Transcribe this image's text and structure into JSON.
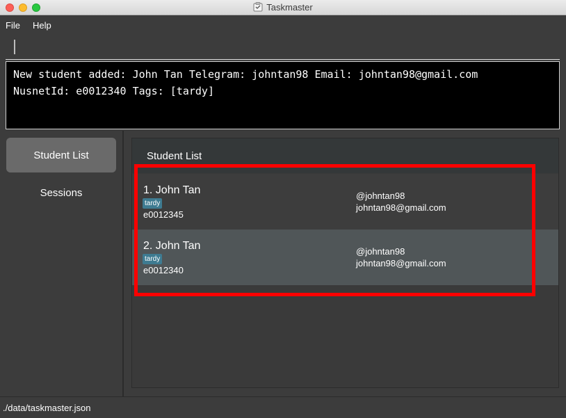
{
  "window": {
    "title": "Taskmaster",
    "app_icon": "taskmaster-app-icon"
  },
  "menu": {
    "items": [
      {
        "label": "File"
      },
      {
        "label": "Help"
      }
    ]
  },
  "command_box": {
    "value": ""
  },
  "result": {
    "lines": [
      "New student added: John Tan Telegram: johntan98 Email: johntan98@gmail.com",
      "NusnetId: e0012340 Tags: [tardy]"
    ]
  },
  "sidebar": {
    "items": [
      {
        "label": "Student List",
        "active": true
      },
      {
        "label": "Sessions",
        "active": false
      }
    ]
  },
  "student_list": {
    "title": "Student List",
    "students": [
      {
        "name": "1.  John Tan",
        "tag": "tardy",
        "nusnet": "e0012345",
        "telegram": "@johntan98",
        "email": "johntan98@gmail.com"
      },
      {
        "name": "2.  John Tan",
        "tag": "tardy",
        "nusnet": "e0012340",
        "telegram": "@johntan98",
        "email": "johntan98@gmail.com"
      }
    ]
  },
  "status_bar": {
    "path": "./data/taskmaster.json"
  },
  "colors": {
    "background": "#3c3c3c",
    "result_background": "#000000",
    "tag": "#3e7b91",
    "selected_row": "#505658",
    "highlight": "#ff0000"
  }
}
